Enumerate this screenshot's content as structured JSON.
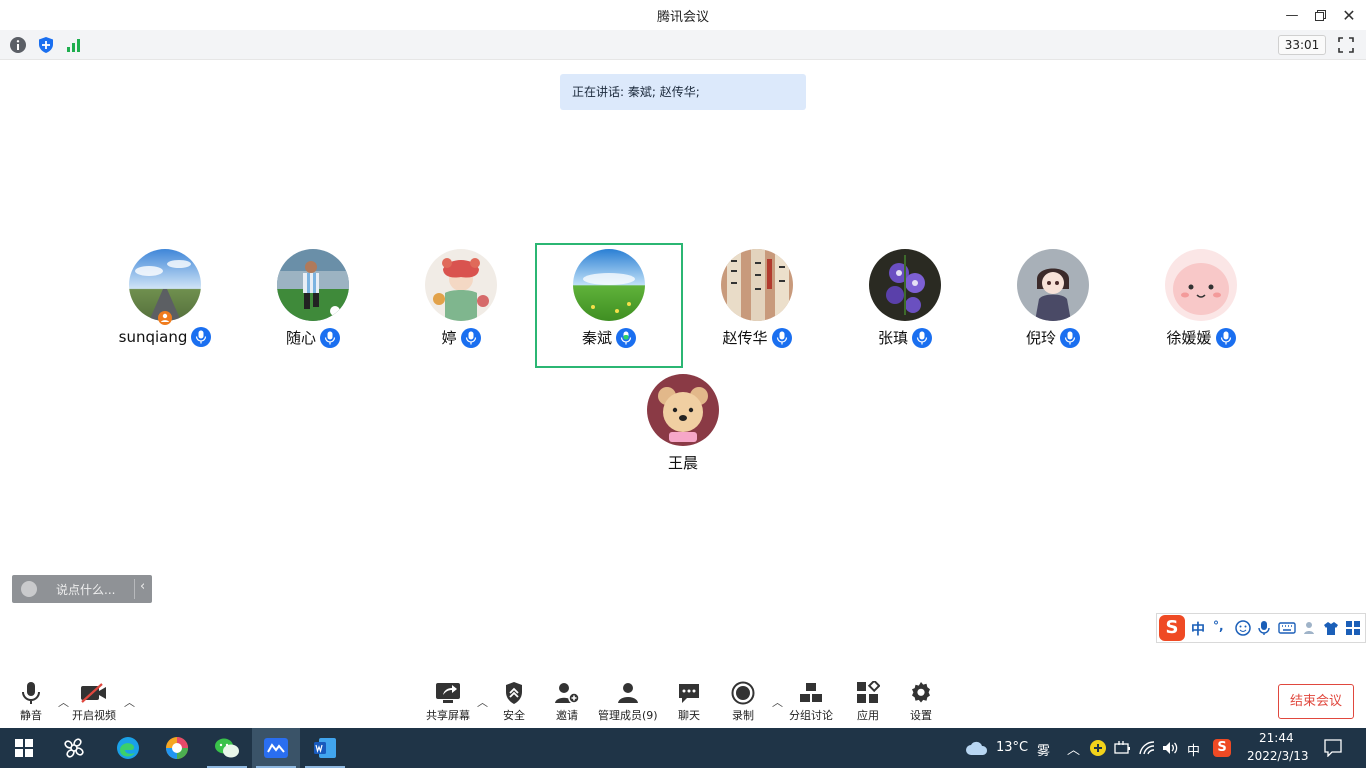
{
  "window": {
    "title": "腾讯会议",
    "minimize_icon": "minimize-icon",
    "restore_icon": "restore-icon",
    "close_icon": "close-icon"
  },
  "infobar": {
    "meeting_info_icon": "info-icon",
    "security_icon": "shield-icon",
    "network_icon": "signal-bars-icon",
    "timer": "33:01",
    "fullscreen_icon": "fullscreen-icon"
  },
  "speaking_banner": "正在讲话: 秦斌; 赵传华;",
  "participants": [
    {
      "name": "sunqiang",
      "host": true,
      "active": false,
      "avatar": "sky-road"
    },
    {
      "name": "随心",
      "host": false,
      "active": false,
      "avatar": "soccer-player"
    },
    {
      "name": "婷",
      "host": false,
      "active": false,
      "avatar": "flower-girl"
    },
    {
      "name": "秦斌",
      "host": false,
      "active": true,
      "avatar": "grassland"
    },
    {
      "name": "赵传华",
      "host": false,
      "active": false,
      "avatar": "calligraphy"
    },
    {
      "name": "张瑱",
      "host": false,
      "active": false,
      "avatar": "purple-flowers"
    },
    {
      "name": "倪玲",
      "host": false,
      "active": false,
      "avatar": "anime-character"
    },
    {
      "name": "徐媛媛",
      "host": false,
      "active": false,
      "avatar": "pink-cute"
    },
    {
      "name": "王晨",
      "host": false,
      "active": false,
      "avatar": "teddy-bear",
      "muted_no_badge": true
    }
  ],
  "chat": {
    "placeholder": "说点什么...",
    "collapse": "‹"
  },
  "ime": {
    "logo": "S",
    "lang": "中",
    "punct": "°,"
  },
  "toolbar": {
    "mute": "静音",
    "video": "开启视频",
    "share": "共享屏幕",
    "security": "安全",
    "invite": "邀请",
    "members": "管理成员(9)",
    "chat": "聊天",
    "record": "录制",
    "breakout": "分组讨论",
    "apps": "应用",
    "settings": "设置",
    "end": "结束会议"
  },
  "taskbar": {
    "weather_temp": "13°C",
    "weather_desc": "雾",
    "ime_lang": "中",
    "time": "21:44",
    "date": "2022/3/13"
  },
  "colors": {
    "accent_blue": "#1a6ff0",
    "active_green": "#2bb673",
    "end_red": "#e0483e",
    "taskbar": "#1f3447"
  }
}
